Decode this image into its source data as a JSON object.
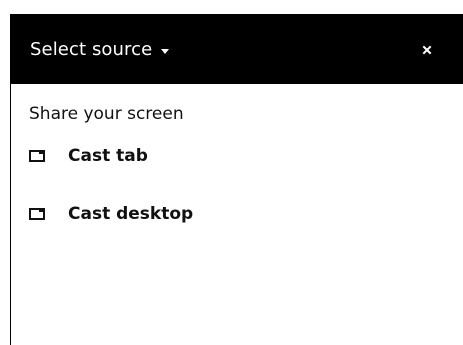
{
  "dialog": {
    "title": "Select source",
    "title_caret_icon": "caret-down-icon",
    "close_icon": "close-icon",
    "section_label": "Share your screen",
    "items": [
      {
        "label": "Cast tab",
        "icon": "tab-icon"
      },
      {
        "label": "Cast desktop",
        "icon": "desktop-icon"
      }
    ]
  },
  "colors": {
    "titlebar_background": "#000000",
    "titlebar_text": "#ffffff",
    "body_background": "#ffffff",
    "body_text": "#111111"
  }
}
